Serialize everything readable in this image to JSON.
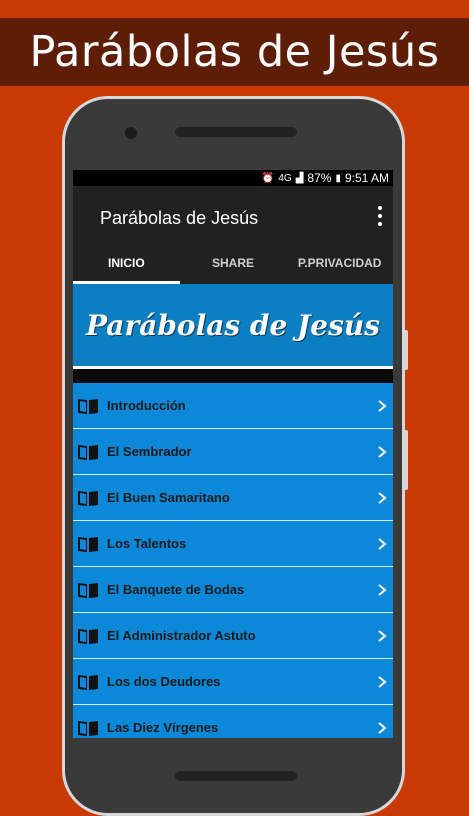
{
  "promo": {
    "title": "Parábolas de Jesús"
  },
  "status_bar": {
    "network": "4G",
    "battery": "87%",
    "time": "9:51 AM"
  },
  "app_bar": {
    "title": "Parábolas de Jesús"
  },
  "tabs": [
    {
      "label": "INICIO",
      "active": true
    },
    {
      "label": "SHARE",
      "active": false
    },
    {
      "label": "P.PRIVACIDAD",
      "active": false
    }
  ],
  "hero": {
    "title": "Parábolas de Jesús"
  },
  "list": [
    {
      "label": "Introducción"
    },
    {
      "label": "El Sembrador"
    },
    {
      "label": "El Buen Samaritano"
    },
    {
      "label": "Los Talentos"
    },
    {
      "label": "El Banquete de Bodas"
    },
    {
      "label": "El Administrador Astuto"
    },
    {
      "label": "Los dos Deudores"
    },
    {
      "label": "Las Diez Vírgenes"
    }
  ],
  "colors": {
    "background": "#c93a05",
    "banner": "#5e1d06",
    "list_blue": "#0b88d8",
    "app_bar": "#212121"
  }
}
